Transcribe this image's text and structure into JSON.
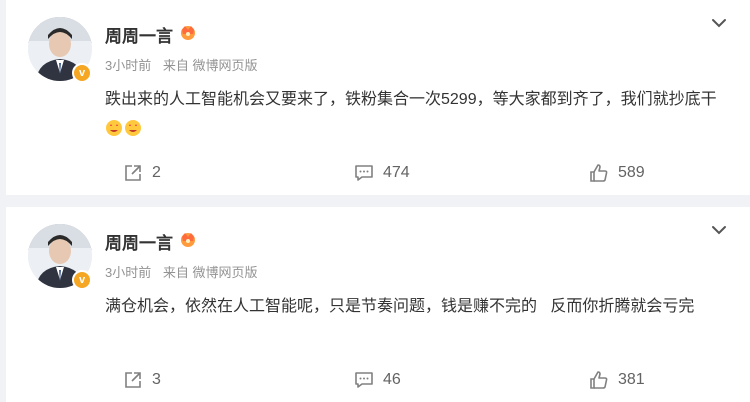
{
  "posts": [
    {
      "author": "周周一言",
      "time": "3小时前",
      "source": "来自 微博网页版",
      "text": "跌出来的人工智能机会又要来了，铁粉集合一次5299，等大家都到齐了，我们就抄底干",
      "emojis": [
        "star-eyes-emoji",
        "star-eyes-emoji"
      ],
      "shares": "2",
      "comments": "474",
      "likes": "589"
    },
    {
      "author": "周周一言",
      "time": "3小时前",
      "source": "来自 微博网页版",
      "text": "满仓机会，依然在人工智能呢，只是节奏问题，钱是赚不完的   反而你折腾就会亏完",
      "emojis": [],
      "shares": "3",
      "comments": "46",
      "likes": "381"
    }
  ],
  "colors": {
    "background": "#f1f2f5",
    "card": "#ffffff",
    "text": "#333333",
    "meta": "#939393",
    "badge": "#f5a623"
  }
}
